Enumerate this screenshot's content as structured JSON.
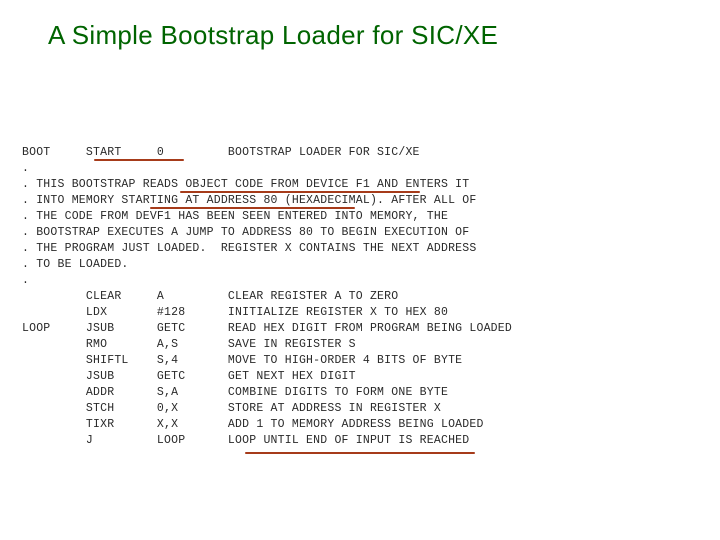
{
  "title": "A Simple Bootstrap Loader for SIC/XE",
  "code": {
    "l00": "BOOT     START     0         BOOTSTRAP LOADER FOR SIC/XE",
    "l01": ".",
    "l02": ". THIS BOOTSTRAP READS OBJECT CODE FROM DEVICE F1 AND ENTERS IT",
    "l03": ". INTO MEMORY STARTING AT ADDRESS 80 (HEXADECIMAL). AFTER ALL OF",
    "l04": ". THE CODE FROM DEVF1 HAS BEEN SEEN ENTERED INTO MEMORY, THE",
    "l05": ". BOOTSTRAP EXECUTES A JUMP TO ADDRESS 80 TO BEGIN EXECUTION OF",
    "l06": ". THE PROGRAM JUST LOADED.  REGISTER X CONTAINS THE NEXT ADDRESS",
    "l07": ". TO BE LOADED.",
    "l08": ".",
    "l09": "         CLEAR     A         CLEAR REGISTER A TO ZERO",
    "l10": "         LDX       #128      INITIALIZE REGISTER X TO HEX 80",
    "l11": "LOOP     JSUB      GETC      READ HEX DIGIT FROM PROGRAM BEING LOADED",
    "l12": "         RMO       A,S       SAVE IN REGISTER S",
    "l13": "         SHIFTL    S,4       MOVE TO HIGH-ORDER 4 BITS OF BYTE",
    "l14": "         JSUB      GETC      GET NEXT HEX DIGIT",
    "l15": "         ADDR      S,A       COMBINE DIGITS TO FORM ONE BYTE",
    "l16": "         STCH      0,X       STORE AT ADDRESS IN REGISTER X",
    "l17": "         TIXR      X,X       ADD 1 TO MEMORY ADDRESS BEING LOADED",
    "l18": "         J         LOOP      LOOP UNTIL END OF INPUT IS REACHED"
  }
}
